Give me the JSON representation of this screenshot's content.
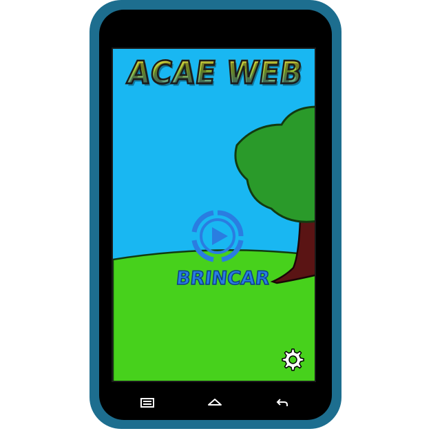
{
  "app": {
    "title": "ACAE WEB",
    "play_label": "BRINCAR"
  },
  "icons": {
    "play": "play-circle-icon",
    "settings": "gear-icon",
    "recent_apps": "recent-apps-icon",
    "home": "home-icon",
    "back": "back-icon"
  },
  "colors": {
    "frame": "#1d6e8f",
    "sky": "#19b7f2",
    "grass": "#47d11c",
    "tree_foliage": "#2a9a2a",
    "tree_trunk": "#5a1414",
    "accent_blue": "#2a7de1"
  }
}
